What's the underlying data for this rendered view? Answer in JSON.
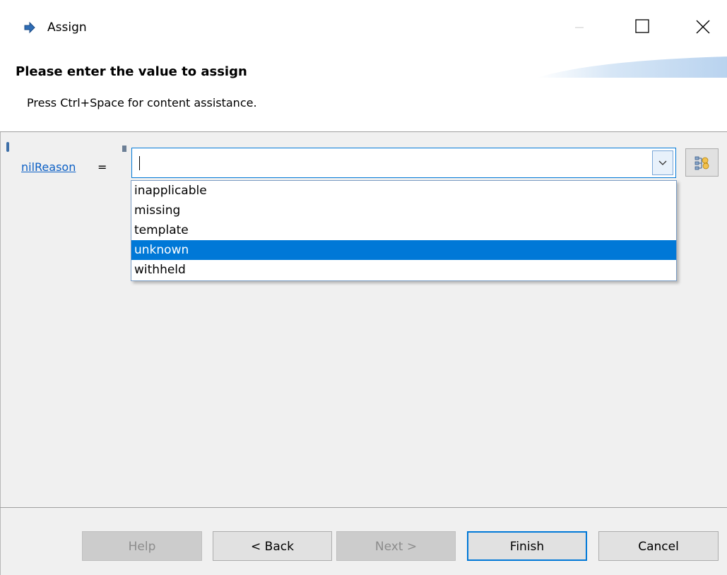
{
  "window": {
    "title": "Assign",
    "icon": "arrow-right-icon",
    "controls": [
      "minimize-icon",
      "maximize-icon",
      "close-icon"
    ]
  },
  "header": {
    "title": "Please enter the value to assign",
    "description": "Press Ctrl+Space for content assistance."
  },
  "field": {
    "label": "nilReason",
    "operator": "=",
    "value": "",
    "dropdown_icon": "chevron-down-icon",
    "side_button_icon": "tree-structure-icon"
  },
  "dropdown": {
    "options": [
      "inapplicable",
      "missing",
      "template",
      "unknown",
      "withheld"
    ],
    "selected": "unknown"
  },
  "footer": {
    "help": "Help",
    "back": "< Back",
    "next": "Next >",
    "finish": "Finish",
    "cancel": "Cancel"
  },
  "colors": {
    "accent": "#0078d7",
    "link": "#0b5fc5",
    "background": "#f0f0f0"
  }
}
